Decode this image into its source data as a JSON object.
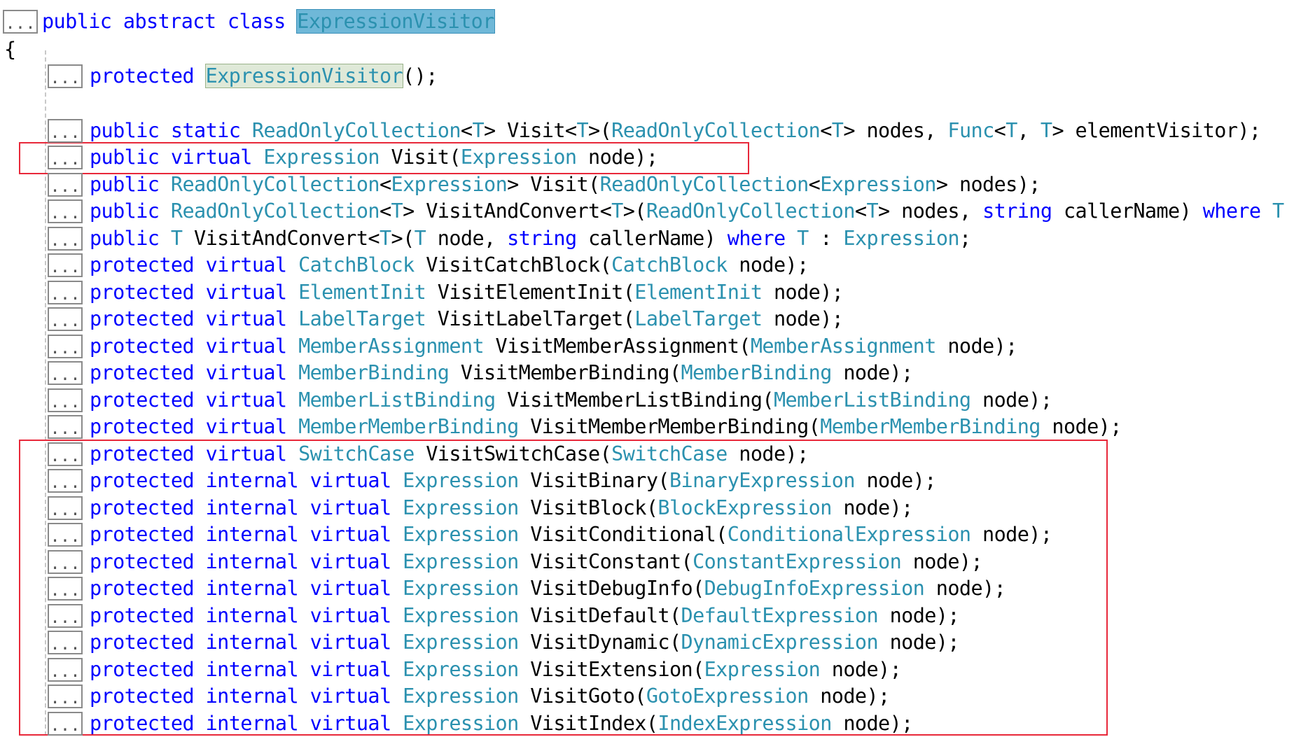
{
  "fold_marker": "...",
  "colors": {
    "keyword": "#0000ff",
    "type": "#2b91af",
    "plain": "#000000",
    "highlight_box": "#e8283a"
  },
  "lines": [
    [
      {
        "t": "public abstract class ",
        "c": "kw"
      },
      {
        "t": "ExpressionVisitor",
        "c": "ty",
        "h": "blue"
      }
    ],
    [
      {
        "t": "{",
        "c": "pl"
      }
    ],
    [
      {
        "t": "protected ",
        "c": "kw"
      },
      {
        "t": "ExpressionVisitor",
        "c": "ty",
        "h": "grey"
      },
      {
        "t": "();",
        "c": "pl"
      }
    ],
    [
      {
        "t": "public static ",
        "c": "kw"
      },
      {
        "t": "ReadOnlyCollection",
        "c": "ty"
      },
      {
        "t": "<",
        "c": "pl"
      },
      {
        "t": "T",
        "c": "ty"
      },
      {
        "t": "> Visit<",
        "c": "pl"
      },
      {
        "t": "T",
        "c": "ty"
      },
      {
        "t": ">(",
        "c": "pl"
      },
      {
        "t": "ReadOnlyCollection",
        "c": "ty"
      },
      {
        "t": "<",
        "c": "pl"
      },
      {
        "t": "T",
        "c": "ty"
      },
      {
        "t": "> nodes, ",
        "c": "pl"
      },
      {
        "t": "Func",
        "c": "ty"
      },
      {
        "t": "<",
        "c": "pl"
      },
      {
        "t": "T",
        "c": "ty"
      },
      {
        "t": ", ",
        "c": "pl"
      },
      {
        "t": "T",
        "c": "ty"
      },
      {
        "t": "> elementVisitor);",
        "c": "pl"
      }
    ],
    [
      {
        "t": "public virtual ",
        "c": "kw"
      },
      {
        "t": "Expression",
        "c": "ty"
      },
      {
        "t": " Visit(",
        "c": "pl"
      },
      {
        "t": "Expression",
        "c": "ty"
      },
      {
        "t": " node);",
        "c": "pl"
      }
    ],
    [
      {
        "t": "public ",
        "c": "kw"
      },
      {
        "t": "ReadOnlyCollection",
        "c": "ty"
      },
      {
        "t": "<",
        "c": "pl"
      },
      {
        "t": "Expression",
        "c": "ty"
      },
      {
        "t": "> Visit(",
        "c": "pl"
      },
      {
        "t": "ReadOnlyCollection",
        "c": "ty"
      },
      {
        "t": "<",
        "c": "pl"
      },
      {
        "t": "Expression",
        "c": "ty"
      },
      {
        "t": "> nodes);",
        "c": "pl"
      }
    ],
    [
      {
        "t": "public ",
        "c": "kw"
      },
      {
        "t": "ReadOnlyCollection",
        "c": "ty"
      },
      {
        "t": "<",
        "c": "pl"
      },
      {
        "t": "T",
        "c": "ty"
      },
      {
        "t": "> VisitAndConvert<",
        "c": "pl"
      },
      {
        "t": "T",
        "c": "ty"
      },
      {
        "t": ">(",
        "c": "pl"
      },
      {
        "t": "ReadOnlyCollection",
        "c": "ty"
      },
      {
        "t": "<",
        "c": "pl"
      },
      {
        "t": "T",
        "c": "ty"
      },
      {
        "t": "> nodes, ",
        "c": "pl"
      },
      {
        "t": "string",
        "c": "kw"
      },
      {
        "t": " callerName) ",
        "c": "pl"
      },
      {
        "t": "where",
        "c": "kw"
      },
      {
        "t": " T",
        "c": "ty"
      }
    ],
    [
      {
        "t": "public ",
        "c": "kw"
      },
      {
        "t": "T",
        "c": "ty"
      },
      {
        "t": " VisitAndConvert<",
        "c": "pl"
      },
      {
        "t": "T",
        "c": "ty"
      },
      {
        "t": ">(",
        "c": "pl"
      },
      {
        "t": "T",
        "c": "ty"
      },
      {
        "t": " node, ",
        "c": "pl"
      },
      {
        "t": "string",
        "c": "kw"
      },
      {
        "t": " callerName) ",
        "c": "pl"
      },
      {
        "t": "where",
        "c": "kw"
      },
      {
        "t": " ",
        "c": "pl"
      },
      {
        "t": "T",
        "c": "ty"
      },
      {
        "t": " : ",
        "c": "pl"
      },
      {
        "t": "Expression",
        "c": "ty"
      },
      {
        "t": ";",
        "c": "pl"
      }
    ],
    [
      {
        "t": "protected virtual ",
        "c": "kw"
      },
      {
        "t": "CatchBlock",
        "c": "ty"
      },
      {
        "t": " VisitCatchBlock(",
        "c": "pl"
      },
      {
        "t": "CatchBlock",
        "c": "ty"
      },
      {
        "t": " node);",
        "c": "pl"
      }
    ],
    [
      {
        "t": "protected virtual ",
        "c": "kw"
      },
      {
        "t": "ElementInit",
        "c": "ty"
      },
      {
        "t": " VisitElementInit(",
        "c": "pl"
      },
      {
        "t": "ElementInit",
        "c": "ty"
      },
      {
        "t": " node);",
        "c": "pl"
      }
    ],
    [
      {
        "t": "protected virtual ",
        "c": "kw"
      },
      {
        "t": "LabelTarget",
        "c": "ty"
      },
      {
        "t": " VisitLabelTarget(",
        "c": "pl"
      },
      {
        "t": "LabelTarget",
        "c": "ty"
      },
      {
        "t": " node);",
        "c": "pl"
      }
    ],
    [
      {
        "t": "protected virtual ",
        "c": "kw"
      },
      {
        "t": "MemberAssignment",
        "c": "ty"
      },
      {
        "t": " VisitMemberAssignment(",
        "c": "pl"
      },
      {
        "t": "MemberAssignment",
        "c": "ty"
      },
      {
        "t": " node);",
        "c": "pl"
      }
    ],
    [
      {
        "t": "protected virtual ",
        "c": "kw"
      },
      {
        "t": "MemberBinding",
        "c": "ty"
      },
      {
        "t": " VisitMemberBinding(",
        "c": "pl"
      },
      {
        "t": "MemberBinding",
        "c": "ty"
      },
      {
        "t": " node);",
        "c": "pl"
      }
    ],
    [
      {
        "t": "protected virtual ",
        "c": "kw"
      },
      {
        "t": "MemberListBinding",
        "c": "ty"
      },
      {
        "t": " VisitMemberListBinding(",
        "c": "pl"
      },
      {
        "t": "MemberListBinding",
        "c": "ty"
      },
      {
        "t": " node);",
        "c": "pl"
      }
    ],
    [
      {
        "t": "protected virtual ",
        "c": "kw"
      },
      {
        "t": "MemberMemberBinding",
        "c": "ty"
      },
      {
        "t": " VisitMemberMemberBinding(",
        "c": "pl"
      },
      {
        "t": "MemberMemberBinding",
        "c": "ty"
      },
      {
        "t": " node);",
        "c": "pl"
      }
    ],
    [
      {
        "t": "protected virtual ",
        "c": "kw"
      },
      {
        "t": "SwitchCase",
        "c": "ty"
      },
      {
        "t": " VisitSwitchCase(",
        "c": "pl"
      },
      {
        "t": "SwitchCase",
        "c": "ty"
      },
      {
        "t": " node);",
        "c": "pl"
      }
    ],
    [
      {
        "t": "protected internal virtual ",
        "c": "kw"
      },
      {
        "t": "Expression",
        "c": "ty"
      },
      {
        "t": " VisitBinary(",
        "c": "pl"
      },
      {
        "t": "BinaryExpression",
        "c": "ty"
      },
      {
        "t": " node);",
        "c": "pl"
      }
    ],
    [
      {
        "t": "protected internal virtual ",
        "c": "kw"
      },
      {
        "t": "Expression",
        "c": "ty"
      },
      {
        "t": " VisitBlock(",
        "c": "pl"
      },
      {
        "t": "BlockExpression",
        "c": "ty"
      },
      {
        "t": " node);",
        "c": "pl"
      }
    ],
    [
      {
        "t": "protected internal virtual ",
        "c": "kw"
      },
      {
        "t": "Expression",
        "c": "ty"
      },
      {
        "t": " VisitConditional(",
        "c": "pl"
      },
      {
        "t": "ConditionalExpression",
        "c": "ty"
      },
      {
        "t": " node);",
        "c": "pl"
      }
    ],
    [
      {
        "t": "protected internal virtual ",
        "c": "kw"
      },
      {
        "t": "Expression",
        "c": "ty"
      },
      {
        "t": " VisitConstant(",
        "c": "pl"
      },
      {
        "t": "ConstantExpression",
        "c": "ty"
      },
      {
        "t": " node);",
        "c": "pl"
      }
    ],
    [
      {
        "t": "protected internal virtual ",
        "c": "kw"
      },
      {
        "t": "Expression",
        "c": "ty"
      },
      {
        "t": " VisitDebugInfo(",
        "c": "pl"
      },
      {
        "t": "DebugInfoExpression",
        "c": "ty"
      },
      {
        "t": " node);",
        "c": "pl"
      }
    ],
    [
      {
        "t": "protected internal virtual ",
        "c": "kw"
      },
      {
        "t": "Expression",
        "c": "ty"
      },
      {
        "t": " VisitDefault(",
        "c": "pl"
      },
      {
        "t": "DefaultExpression",
        "c": "ty"
      },
      {
        "t": " node);",
        "c": "pl"
      }
    ],
    [
      {
        "t": "protected internal virtual ",
        "c": "kw"
      },
      {
        "t": "Expression",
        "c": "ty"
      },
      {
        "t": " VisitDynamic(",
        "c": "pl"
      },
      {
        "t": "DynamicExpression",
        "c": "ty"
      },
      {
        "t": " node);",
        "c": "pl"
      }
    ],
    [
      {
        "t": "protected internal virtual ",
        "c": "kw"
      },
      {
        "t": "Expression",
        "c": "ty"
      },
      {
        "t": " VisitExtension(",
        "c": "pl"
      },
      {
        "t": "Expression",
        "c": "ty"
      },
      {
        "t": " node);",
        "c": "pl"
      }
    ],
    [
      {
        "t": "protected internal virtual ",
        "c": "kw"
      },
      {
        "t": "Expression",
        "c": "ty"
      },
      {
        "t": " VisitGoto(",
        "c": "pl"
      },
      {
        "t": "GotoExpression",
        "c": "ty"
      },
      {
        "t": " node);",
        "c": "pl"
      }
    ],
    [
      {
        "t": "protected internal virtual ",
        "c": "kw"
      },
      {
        "t": "Expression",
        "c": "ty"
      },
      {
        "t": " VisitIndex(",
        "c": "pl"
      },
      {
        "t": "IndexExpression",
        "c": "ty"
      },
      {
        "t": " node);",
        "c": "pl"
      }
    ]
  ]
}
